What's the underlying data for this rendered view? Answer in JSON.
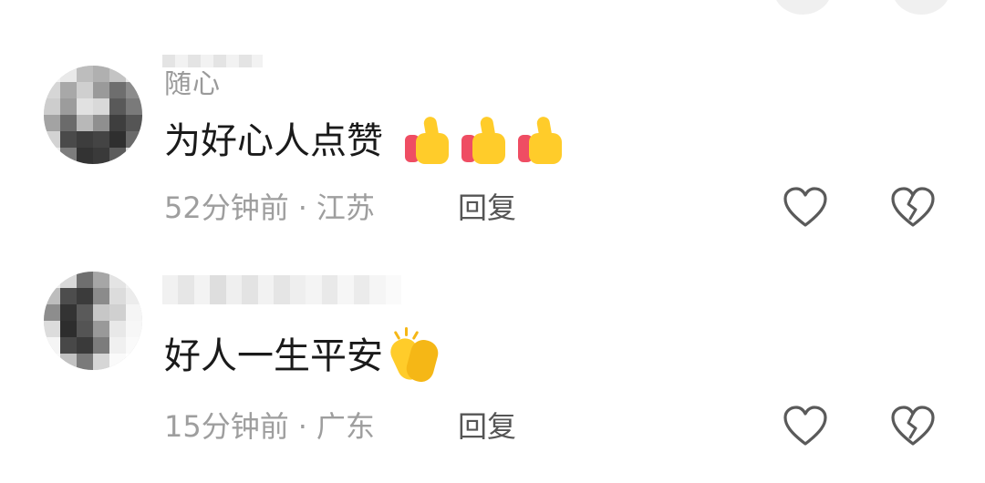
{
  "comments": [
    {
      "username": "随心",
      "text": "为好心人点赞",
      "emojis": [
        "thumbs-up-icon",
        "thumbs-up-icon",
        "thumbs-up-icon"
      ],
      "time": "52分钟前",
      "separator": "·",
      "location": "江苏",
      "reply_label": "回复"
    },
    {
      "username": "",
      "text": "好人一生平安",
      "emojis": [
        "clapping-hands-icon"
      ],
      "time": "15分钟前",
      "separator": "·",
      "location": "广东",
      "reply_label": "回复"
    }
  ],
  "colors": {
    "text_primary": "#1a1a1a",
    "text_secondary": "#9e9e9e",
    "reply_text": "#555555",
    "icon_stroke": "#5a5a5a"
  }
}
